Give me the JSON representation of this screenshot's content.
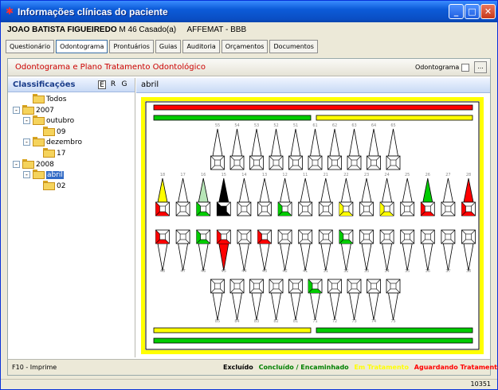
{
  "window": {
    "title": "Informações clínicas do paciente"
  },
  "patient": {
    "name": "JOAO BATISTA FIGUEIREDO",
    "sex": "M",
    "age": "46",
    "status": "Casado(a)",
    "plan": "AFFEMAT - BBB"
  },
  "tabs": [
    "Questionário",
    "Odontograma",
    "Prontuários",
    "Guias",
    "Auditoria",
    "Orçamentos",
    "Documentos"
  ],
  "active_tab": "Odontograma",
  "panel": {
    "title": "Odontograma e Plano Tratamento Odontológico",
    "odontograma_label": "Odontograma",
    "button_label": "...",
    "footer_hint": "F10 - Imprime"
  },
  "classificacoes": {
    "title": "Classificações",
    "buttons": [
      "E",
      "R",
      "G"
    ],
    "tree": [
      {
        "label": "Todos",
        "level": 1,
        "expander": ""
      },
      {
        "label": "2007",
        "level": 0,
        "expander": "-"
      },
      {
        "label": "outubro",
        "level": 1,
        "expander": "-"
      },
      {
        "label": "09",
        "level": 2,
        "expander": ""
      },
      {
        "label": "dezembro",
        "level": 1,
        "expander": "-"
      },
      {
        "label": "17",
        "level": 2,
        "expander": ""
      },
      {
        "label": "2008",
        "level": 0,
        "expander": "-"
      },
      {
        "label": "abril",
        "level": 1,
        "expander": "-",
        "selected": true
      },
      {
        "label": "02",
        "level": 2,
        "expander": ""
      }
    ]
  },
  "period": "abril",
  "legend": [
    {
      "label": "Excluído",
      "color": "#000000"
    },
    {
      "label": "Concluído / Encaminhado",
      "color": "#008000"
    },
    {
      "label": "Em Tratamento",
      "color": "#ffff00"
    },
    {
      "label": "Aguardando Tratamento",
      "color": "#ff0000"
    }
  ],
  "colors": {
    "red": "#ff0000",
    "green": "#00cc00",
    "yellow": "#ffff00",
    "black": "#000000",
    "lightgreen": "#b8e6b8",
    "frame": "#ffff00"
  },
  "bars": {
    "top_full": "red",
    "top_left": "green",
    "top_right": "yellow",
    "bottom_left": "yellow",
    "bottom_right": "green",
    "bottom_full": "green"
  },
  "odontogram": {
    "upper_primary": [
      {
        "n": "55"
      },
      {
        "n": "54"
      },
      {
        "n": "53"
      },
      {
        "n": "52"
      },
      {
        "n": "51"
      },
      {
        "n": "61"
      },
      {
        "n": "62"
      },
      {
        "n": "63"
      },
      {
        "n": "64"
      },
      {
        "n": "65"
      }
    ],
    "upper_permanent": [
      {
        "n": "18",
        "root": "yellow",
        "crown": "red"
      },
      {
        "n": "17"
      },
      {
        "n": "16",
        "root": "lightgreen",
        "crown": "green"
      },
      {
        "n": "15",
        "root": "black",
        "crown": "black"
      },
      {
        "n": "14"
      },
      {
        "n": "13"
      },
      {
        "n": "12",
        "crown": "green"
      },
      {
        "n": "11"
      },
      {
        "n": "21"
      },
      {
        "n": "22",
        "crown": "yellow"
      },
      {
        "n": "23"
      },
      {
        "n": "24",
        "crown": "yellow"
      },
      {
        "n": "25"
      },
      {
        "n": "26",
        "root": "green",
        "crown": "red"
      },
      {
        "n": "27"
      },
      {
        "n": "28",
        "root": "red",
        "crown": "red"
      }
    ],
    "lower_permanent": [
      {
        "n": "48",
        "crown": "red"
      },
      {
        "n": "47"
      },
      {
        "n": "46",
        "crown": "green"
      },
      {
        "n": "45",
        "root": "red",
        "crown": "red"
      },
      {
        "n": "44"
      },
      {
        "n": "43",
        "crown": "red"
      },
      {
        "n": "42"
      },
      {
        "n": "41"
      },
      {
        "n": "31"
      },
      {
        "n": "32",
        "crown": "green"
      },
      {
        "n": "33"
      },
      {
        "n": "34"
      },
      {
        "n": "35"
      },
      {
        "n": "36"
      },
      {
        "n": "37"
      },
      {
        "n": "38"
      }
    ],
    "lower_primary": [
      {
        "n": "85"
      },
      {
        "n": "84"
      },
      {
        "n": "83"
      },
      {
        "n": "82"
      },
      {
        "n": "81"
      },
      {
        "n": "71",
        "crown": "green"
      },
      {
        "n": "72"
      },
      {
        "n": "73"
      },
      {
        "n": "74"
      },
      {
        "n": "75"
      }
    ]
  },
  "status_right": "10351"
}
